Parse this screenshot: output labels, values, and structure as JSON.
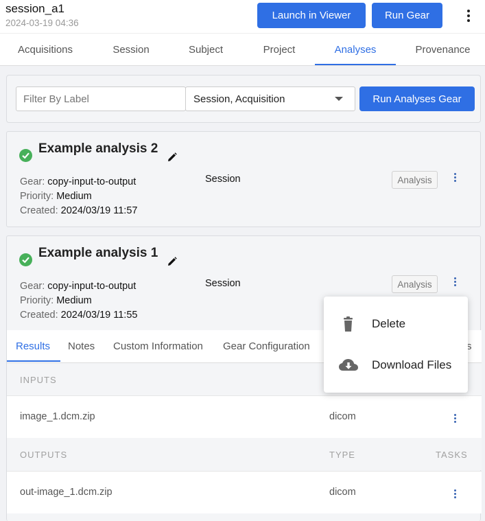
{
  "header": {
    "session_title": "session_a1",
    "session_date": "2024-03-19 04:36",
    "launch_viewer_label": "Launch in Viewer",
    "run_gear_label": "Run Gear",
    "more_icon": "kebab-vertical-icon"
  },
  "tabs": [
    {
      "label": "Acquisitions",
      "active": false
    },
    {
      "label": "Session",
      "active": false
    },
    {
      "label": "Subject",
      "active": false
    },
    {
      "label": "Project",
      "active": false
    },
    {
      "label": "Analyses",
      "active": true
    },
    {
      "label": "Provenance",
      "active": false
    }
  ],
  "filter": {
    "placeholder": "Filter By Label",
    "select_value": "Session, Acquisition",
    "run_analyses_label": "Run Analyses Gear"
  },
  "analyses": [
    {
      "title": "Example analysis 2",
      "gear_label": "Gear:",
      "gear": "copy-input-to-output",
      "priority_label": "Priority:",
      "priority": "Medium",
      "created_label": "Created:",
      "created": "2024/03/19 11:57",
      "scope": "Session",
      "badge": "Analysis",
      "status": "complete"
    },
    {
      "title": "Example analysis 1",
      "gear_label": "Gear:",
      "gear": "copy-input-to-output",
      "priority_label": "Priority:",
      "priority": "Medium",
      "created_label": "Created:",
      "created": "2024/03/19 11:55",
      "scope": "Session",
      "badge": "Analysis",
      "status": "complete"
    }
  ],
  "detail_tabs": [
    {
      "label": "Results",
      "active": true
    },
    {
      "label": "Notes",
      "active": false
    },
    {
      "label": "Custom Information",
      "active": false
    },
    {
      "label": "Gear Configuration",
      "active": false
    },
    {
      "label": "s",
      "active": false
    }
  ],
  "results": {
    "inputs_header": "INPUTS",
    "inputs": [
      {
        "name": "image_1.dcm.zip",
        "type": "dicom"
      }
    ],
    "outputs_header": "OUTPUTS",
    "type_header": "TYPE",
    "tasks_header": "TASKS",
    "outputs": [
      {
        "name": "out-image_1.dcm.zip",
        "type": "dicom"
      }
    ]
  },
  "context_menu": {
    "items": [
      {
        "label": "Delete",
        "icon": "trash-icon"
      },
      {
        "label": "Download Files",
        "icon": "cloud-download-icon"
      }
    ]
  },
  "colors": {
    "primary": "#2f6fe4",
    "success": "#47b05a",
    "kebab": "#3a65b3"
  }
}
